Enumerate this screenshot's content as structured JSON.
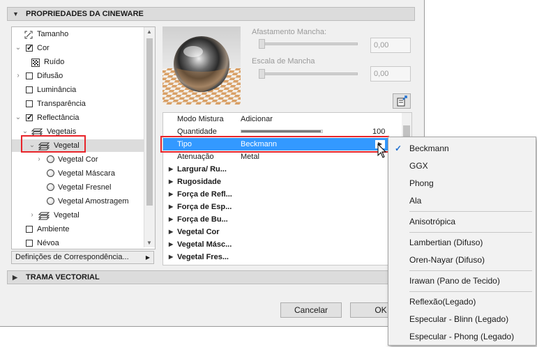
{
  "sections": {
    "cineware_title": "PROPRIEDADES DA CINEWARE",
    "vector_title": "TRAMA VECTORIAL"
  },
  "tree": [
    {
      "label": "Tamanho",
      "kind": "icon",
      "icon": "resize-icon",
      "indent": 0
    },
    {
      "label": "Cor",
      "kind": "checkbox",
      "checked": true,
      "expanded": true,
      "indent": 0
    },
    {
      "label": "Ruído",
      "kind": "icon",
      "icon": "noise-icon",
      "indent": 1
    },
    {
      "label": "Difusão",
      "kind": "checkbox",
      "checked": false,
      "expanded": false,
      "indent": 0
    },
    {
      "label": "Luminância",
      "kind": "checkbox",
      "checked": false,
      "indent": 0
    },
    {
      "label": "Transparência",
      "kind": "checkbox",
      "checked": false,
      "indent": 0
    },
    {
      "label": "Reflectância",
      "kind": "checkbox",
      "checked": true,
      "expanded": true,
      "indent": 0
    },
    {
      "label": "Vegetais",
      "kind": "icon",
      "icon": "layers-icon",
      "expanded": true,
      "indent": 1
    },
    {
      "label": "Vegetal",
      "kind": "icon",
      "icon": "layers-icon",
      "expanded": true,
      "indent": 2,
      "selected": true
    },
    {
      "label": "Vegetal Cor",
      "kind": "radio",
      "expanded": false,
      "indent": 3
    },
    {
      "label": "Vegetal Máscara",
      "kind": "radio",
      "indent": 3
    },
    {
      "label": "Vegetal Fresnel",
      "kind": "radio",
      "indent": 3
    },
    {
      "label": "Vegetal Amostragem",
      "kind": "radio",
      "indent": 3
    },
    {
      "label": "Vegetal",
      "kind": "icon",
      "icon": "layers-icon",
      "expanded": false,
      "indent": 2
    },
    {
      "label": "Ambiente",
      "kind": "checkbox",
      "checked": false,
      "indent": 0
    },
    {
      "label": "Névoa",
      "kind": "checkbox",
      "checked": false,
      "indent": 0
    }
  ],
  "match_definitions": "Definições de Correspondência...",
  "spot": {
    "distance_label": "Afastamento Mancha:",
    "distance_value": "0,00",
    "scale_label": "Escala de Mancha",
    "scale_value": "0,00"
  },
  "props": {
    "rows": [
      {
        "key": "Modo Mistura",
        "value": "Adicionar"
      },
      {
        "key": "Quantidade",
        "value": "100"
      },
      {
        "key": "Tipo",
        "value": "Beckmann"
      },
      {
        "key": "Atenuação",
        "value": "Metal"
      }
    ],
    "groups": [
      "Largura/ Ru...",
      "Rugosidade",
      "Força de Refl...",
      "Força de Esp...",
      "Força de Bu...",
      "Vegetal Cor",
      "Vegetal Másc...",
      "Vegetal Fres..."
    ],
    "quantity_fraction": 0.98
  },
  "menu": {
    "items": [
      "Beckmann",
      "GGX",
      "Phong",
      "Ala",
      "Anisotrópica",
      "Lambertian (Difuso)",
      "Oren-Nayar (Difuso)",
      "Irawan (Pano de Tecido)",
      "Reflexão(Legado)",
      "Especular - Blinn (Legado)",
      "Especular - Phong (Legado)"
    ],
    "checked_item": "Beckmann"
  },
  "buttons": {
    "cancel": "Cancelar",
    "ok": "OK"
  },
  "colors": {
    "selection": "#3399ff",
    "highlight_outline": "#e8242a"
  }
}
